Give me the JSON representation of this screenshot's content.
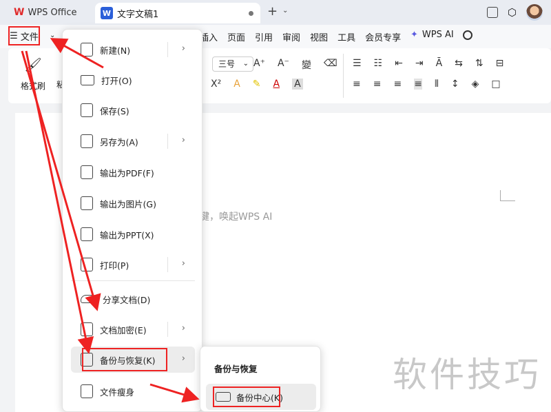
{
  "titlebar": {
    "home_tab": "WPS Office",
    "doc_tab": "文字文稿1"
  },
  "menubar": {
    "file_label": "文件",
    "items": [
      "插入",
      "页面",
      "引用",
      "审阅",
      "视图",
      "工具",
      "会员专享"
    ],
    "wps_ai": "WPS AI"
  },
  "ribbon": {
    "format_painter": "格式刷",
    "paste_partial": "粘",
    "font_size": "三号"
  },
  "document": {
    "placeholder": "键，唤起WPS AI"
  },
  "file_menu": {
    "items": [
      {
        "label": "新建(N)",
        "icon": "new-doc-icon",
        "submenu": true
      },
      {
        "label": "打开(O)",
        "icon": "folder-icon",
        "submenu": false
      },
      {
        "label": "保存(S)",
        "icon": "save-icon",
        "submenu": false
      },
      {
        "label": "另存为(A)",
        "icon": "save-as-icon",
        "submenu": true
      },
      {
        "label": "输出为PDF(F)",
        "icon": "pdf-icon",
        "submenu": false
      },
      {
        "label": "输出为图片(G)",
        "icon": "image-icon",
        "submenu": false
      },
      {
        "label": "输出为PPT(X)",
        "icon": "ppt-icon",
        "submenu": false
      },
      {
        "label": "打印(P)",
        "icon": "print-icon",
        "submenu": true
      },
      {
        "label": "分享文档(D)",
        "icon": "share-cloud-icon",
        "submenu": false
      },
      {
        "label": "文档加密(E)",
        "icon": "lock-doc-icon",
        "submenu": true
      },
      {
        "label": "备份与恢复(K)",
        "icon": "backup-icon",
        "submenu": true
      },
      {
        "label": "文件瘦身",
        "icon": "slim-icon",
        "submenu": false
      }
    ]
  },
  "backup_submenu": {
    "title": "备份与恢复",
    "item": "备份中心(K)"
  },
  "watermark": "软件技巧",
  "colors": {
    "highlight_red": "#e22222",
    "wps_red": "#e02b2b",
    "writer_blue": "#2b5fd9"
  }
}
